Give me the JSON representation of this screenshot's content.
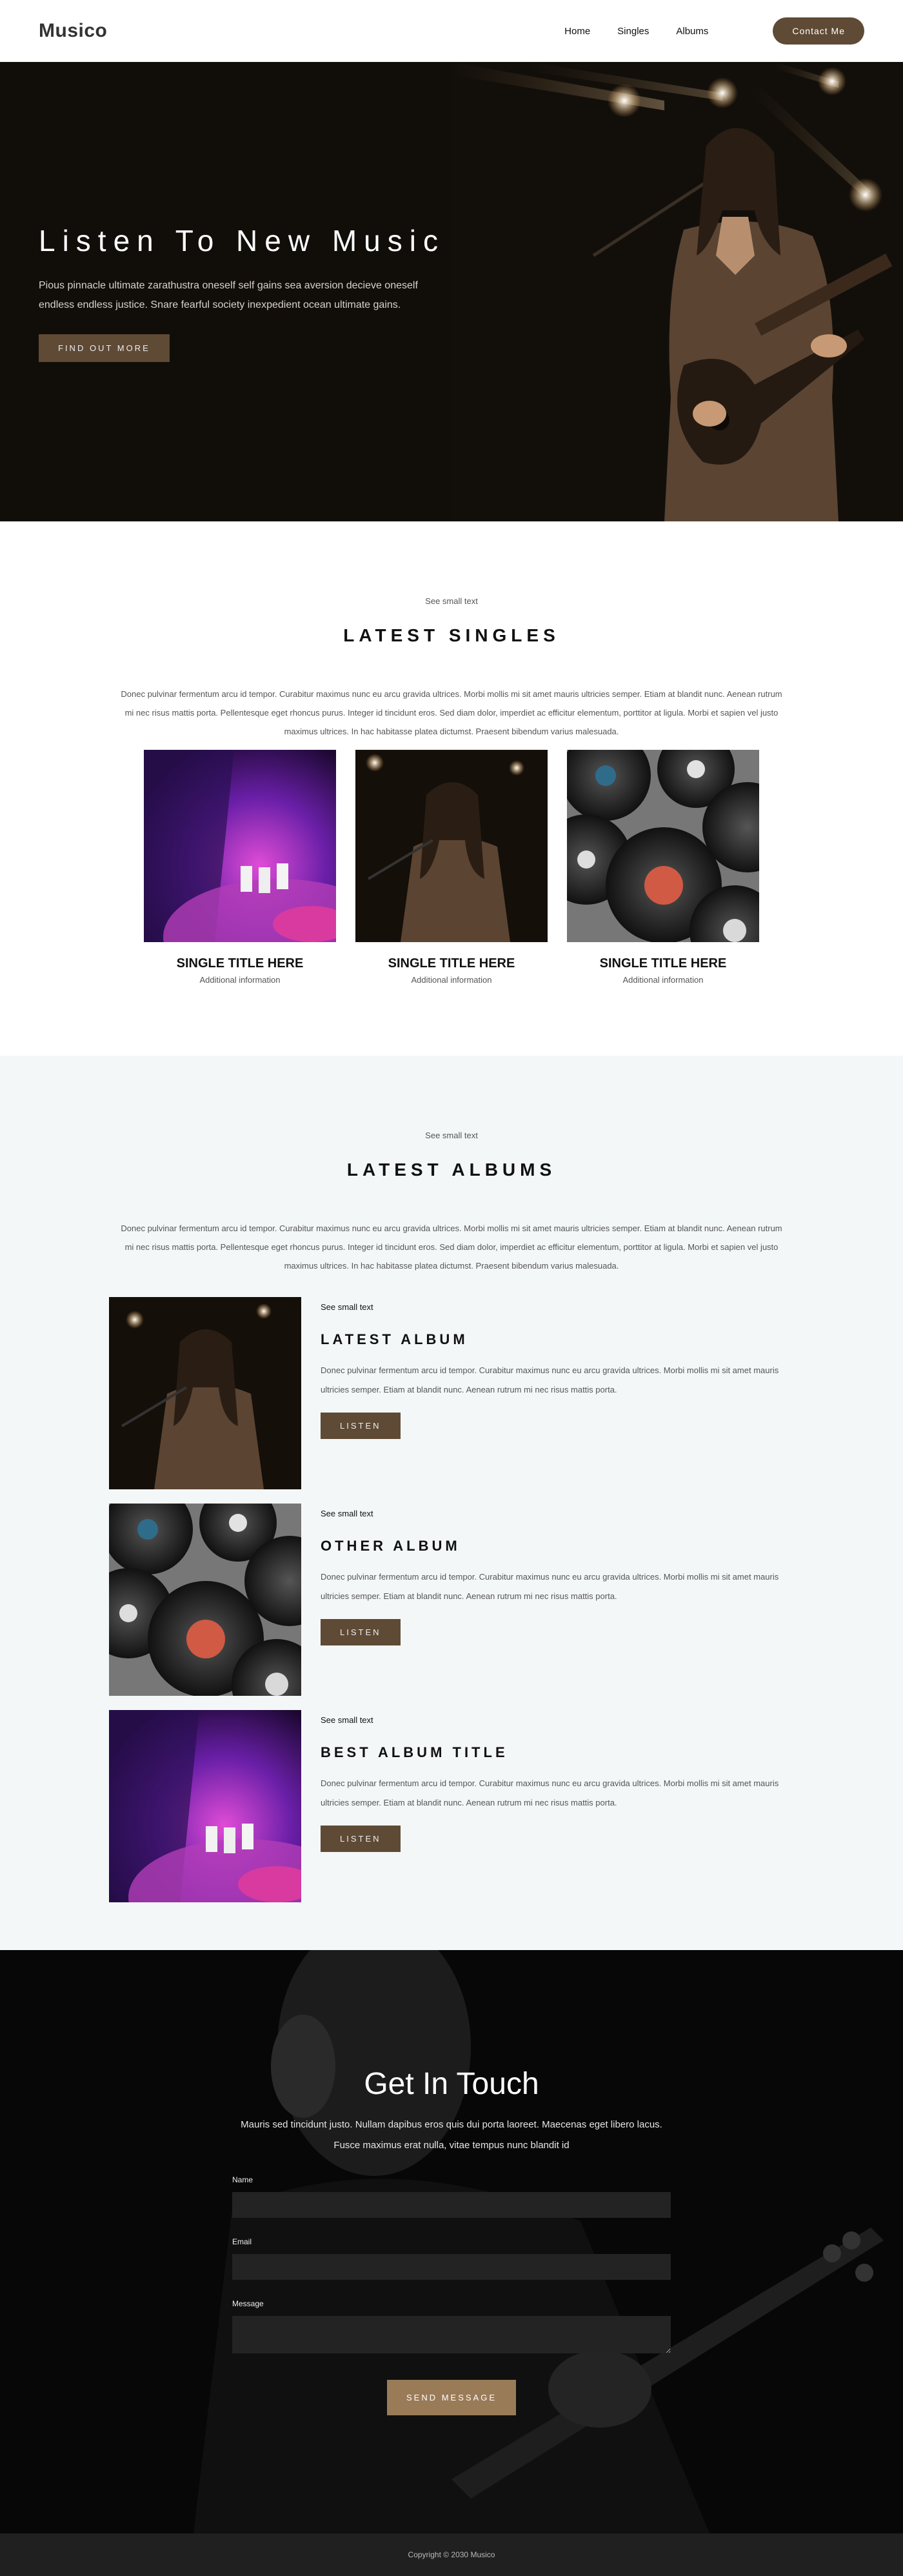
{
  "nav": {
    "logo": "Musico",
    "links": [
      "Home",
      "Singles",
      "Albums"
    ],
    "contact": "Contact Me"
  },
  "hero": {
    "title": "Listen To New Music",
    "description": "Pious pinnacle ultimate zarathustra oneself self gains sea aversion decieve oneself endless endless justice. Snare fearful society inexpedient ocean ultimate gains.",
    "button": "FIND OUT MORE"
  },
  "singles": {
    "small_text": "See small text",
    "title": "LATEST SINGLES",
    "description": "Donec pulvinar fermentum arcu id tempor. Curabitur maximus nunc eu arcu gravida ultrices. Morbi mollis mi sit amet mauris ultricies semper. Etiam at blandit nunc. Aenean rutrum mi nec risus mattis porta. Pellentesque eget rhoncus purus. Integer id tincidunt eros. Sed diam dolor, imperdiet ac efficitur elementum, porttitor at ligula. Morbi et sapien vel justo maximus ultrices. In hac habitasse platea dictumst. Praesent bibendum varius malesuada.",
    "items": [
      {
        "title": "SINGLE TITLE HERE",
        "info": "Additional information"
      },
      {
        "title": "SINGLE TITLE HERE",
        "info": "Additional information"
      },
      {
        "title": "SINGLE TITLE HERE",
        "info": "Additional information"
      }
    ]
  },
  "albums": {
    "small_text": "See small text",
    "title": "LATEST ALBUMS",
    "description": "Donec pulvinar fermentum arcu id tempor. Curabitur maximus nunc eu arcu gravida ultrices. Morbi mollis mi sit amet mauris ultricies semper. Etiam at blandit nunc. Aenean rutrum mi nec risus mattis porta. Pellentesque eget rhoncus purus. Integer id tincidunt eros. Sed diam dolor, imperdiet ac efficitur elementum, porttitor at ligula. Morbi et sapien vel justo maximus ultrices. In hac habitasse platea dictumst. Praesent bibendum varius malesuada.",
    "items": [
      {
        "small": "See small text",
        "title": "LATEST ALBUM",
        "description": "Donec pulvinar fermentum arcu id tempor. Curabitur maximus nunc eu arcu gravida ultrices. Morbi mollis mi sit amet mauris ultricies semper. Etiam at blandit nunc. Aenean rutrum mi nec risus mattis porta.",
        "button": "LISTEN"
      },
      {
        "small": "See small text",
        "title": "OTHER ALBUM",
        "description": "Donec pulvinar fermentum arcu id tempor. Curabitur maximus nunc eu arcu gravida ultrices. Morbi mollis mi sit amet mauris ultricies semper. Etiam at blandit nunc. Aenean rutrum mi nec risus mattis porta.",
        "button": "LISTEN"
      },
      {
        "small": "See small text",
        "title": "BEST ALBUM TITLE",
        "description": "Donec pulvinar fermentum arcu id tempor. Curabitur maximus nunc eu arcu gravida ultrices. Morbi mollis mi sit amet mauris ultricies semper. Etiam at blandit nunc. Aenean rutrum mi nec risus mattis porta.",
        "button": "LISTEN"
      }
    ]
  },
  "contact": {
    "title": "Get In Touch",
    "description": "Mauris sed tincidunt justo. Nullam dapibus eros quis dui porta laoreet. Maecenas eget libero lacus. Fusce maximus erat nulla, vitae tempus nunc blandit id",
    "name_label": "Name",
    "email_label": "Email",
    "message_label": "Message",
    "button": "SEND MESSAGE"
  },
  "footer": {
    "copyright": "Copyright © 2030 Musico"
  },
  "colors": {
    "accent": "#5e4a35",
    "accent_light": "#9a7b58",
    "albums_bg": "#f4f7f8",
    "footer_bg": "#202020"
  }
}
